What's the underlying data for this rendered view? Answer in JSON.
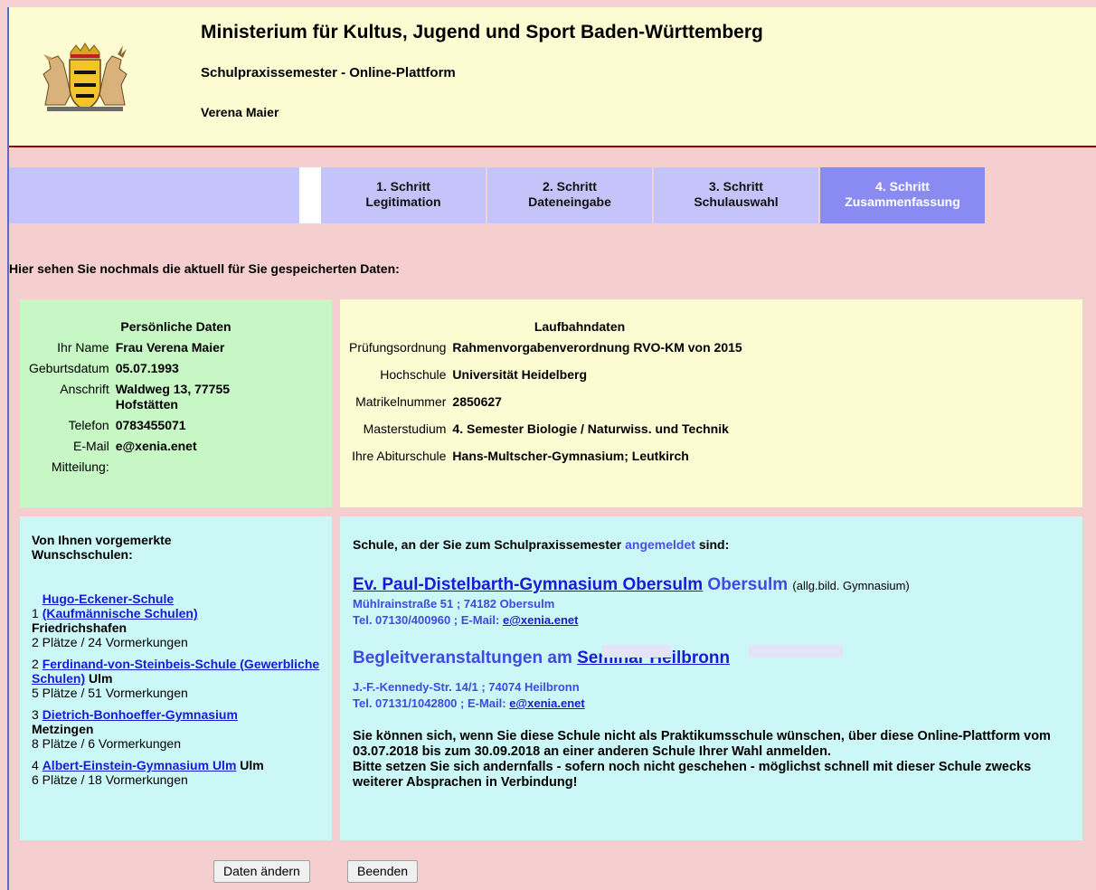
{
  "header": {
    "ministry": "Ministerium für Kultus, Jugend und Sport Baden-Württemberg",
    "platform": "Schulpraxissemester - Online-Plattform",
    "user": "Verena Maier"
  },
  "nav": {
    "steps": [
      {
        "line1": "1. Schritt",
        "line2": "Legitimation"
      },
      {
        "line1": "2. Schritt",
        "line2": "Dateneingabe"
      },
      {
        "line1": "3. Schritt",
        "line2": "Schulauswahl"
      },
      {
        "line1": "4. Schritt",
        "line2": "Zusammenfassung"
      }
    ],
    "active_step": 4
  },
  "intro": "Hier sehen Sie nochmals die aktuell für Sie gespeicherten Daten:",
  "personal": {
    "title": "Persönliche Daten",
    "rows": [
      {
        "label": "Ihr Name",
        "value": "Frau Verena Maier"
      },
      {
        "label": "Geburtsdatum",
        "value": "05.07.1993"
      },
      {
        "label": "Anschrift",
        "value": "Waldweg 13, 77755 Hofstätten"
      },
      {
        "label": "Telefon",
        "value": "0783455071"
      },
      {
        "label": "E-Mail",
        "value": "e@xenia.enet"
      },
      {
        "label": "Mitteilung:",
        "value": ""
      }
    ]
  },
  "career": {
    "title": "Laufbahndaten",
    "rows": [
      {
        "label": "Prüfungsordnung",
        "value": "Rahmenvorgabenverordnung RVO-KM von 2015"
      },
      {
        "label": "Hochschule",
        "value": "Universität Heidelberg"
      },
      {
        "label": "Matrikelnummer",
        "value": "2850627"
      },
      {
        "label": "Masterstudium",
        "value": "4. Semester Biologie / Naturwiss. und Technik"
      },
      {
        "label": "Ihre Abiturschule",
        "value": "Hans-Multscher-Gymnasium; Leutkirch"
      }
    ]
  },
  "wishlist": {
    "title": "Von Ihnen vorgemerkte Wunschschulen:",
    "items": [
      {
        "num": "1",
        "link": "Hugo-Eckener-Schule (Kaufmännische Schulen)",
        "city": "Friedrichshafen",
        "stats": "2 Plätze / 24 Vormerkungen"
      },
      {
        "num": "2",
        "link": "Ferdinand-von-Steinbeis-Schule (Gewerbliche Schulen)",
        "city": "Ulm",
        "stats": "5 Plätze / 51 Vormerkungen"
      },
      {
        "num": "3",
        "link": "Dietrich-Bonhoeffer-Gymnasium",
        "city": "Metzingen",
        "stats": "8 Plätze / 6 Vormerkungen"
      },
      {
        "num": "4",
        "link": "Albert-Einstein-Gymnasium Ulm",
        "city": "Ulm",
        "stats": "6 Plätze / 18 Vormerkungen"
      }
    ]
  },
  "school": {
    "intro_before": "Schule, an der Sie zum Schulpraxissemester",
    "intro_highlight": "angemeldet",
    "intro_after": "sind:",
    "name": "Ev. Paul-Distelbarth-Gymnasium Obersulm",
    "city": "Obersulm",
    "type": "(allg.bild. Gymnasium)",
    "address": "Mühlrainstraße 51 ; 74182 Obersulm",
    "contact_prefix": "Tel. 07130/400960 ; E-Mail:",
    "email": "e@xenia.enet",
    "seminar_prefix": "Begleitveranstaltungen am",
    "seminar_link": "Seminar Heilbronn",
    "seminar_address": "J.-F.-Kennedy-Str. 14/1 ; 74074 Heilbronn",
    "seminar_contact_prefix": "Tel. 07131/1042800 ; E-Mail:",
    "seminar_email": "e@xenia.enet",
    "notice_1": "Sie können sich, wenn Sie diese Schule nicht als Praktikumsschule wünschen, über diese Online-Plattform vom 03.07.2018 bis zum 30.09.2018 an einer anderen Schule Ihrer Wahl anmelden.",
    "notice_2": "Bitte setzen Sie sich andernfalls - sofern noch nicht geschehen - möglichst schnell mit dieser Schule zwecks weiterer Absprachen in Verbindung!"
  },
  "buttons": {
    "edit": "Daten ändern",
    "quit": "Beenden"
  },
  "colors": {
    "header_bg": "#fdfbd2",
    "page_bg": "#f5cfcf",
    "nav_bg": "#c4c4fb",
    "nav_active_bg": "#8a8af3",
    "personal_bg": "#c6f7c4",
    "school_bg": "#ccf7f7",
    "link": "#1a1ad6",
    "accent_blue": "#3f49e3"
  },
  "icons": {
    "coat_of_arms": "baden-wuerttemberg-coat-of-arms-icon"
  }
}
